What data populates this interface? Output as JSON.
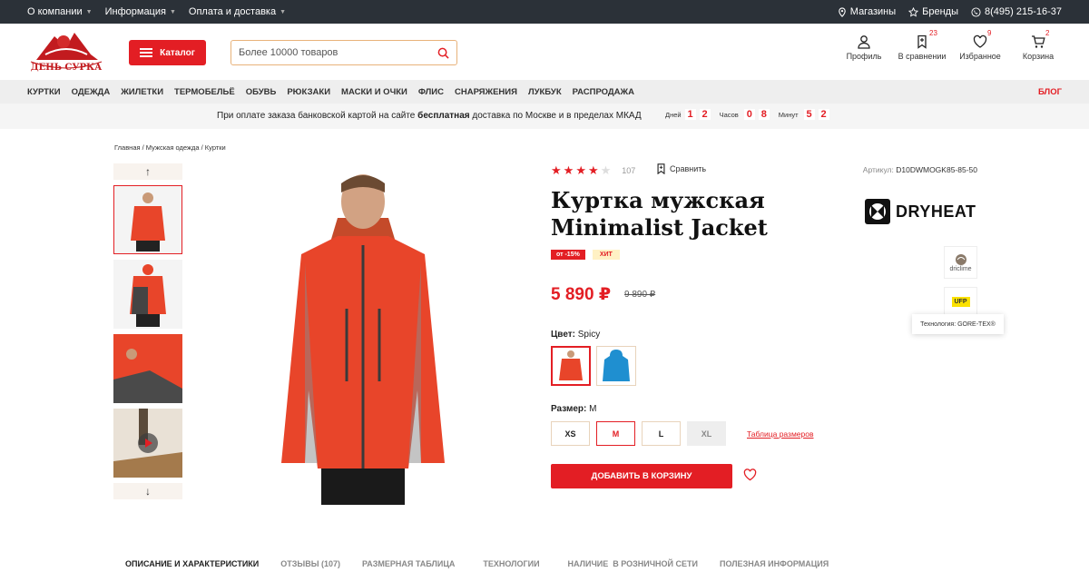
{
  "topbar": {
    "menu": [
      "О компании",
      "Информация",
      "Оплата и доставка"
    ],
    "stores": "Магазины",
    "brands": "Бренды",
    "phone": "8(495) 215-16-37"
  },
  "header": {
    "logo_text": "ДЕНЬ СУРКА",
    "catalog": "Каталог",
    "search_placeholder": "Более 10000 товаров",
    "profile": "Профиль",
    "compare": "В сравнении",
    "compare_count": "23",
    "favorites": "Избранное",
    "favorites_count": "9",
    "cart": "Корзина",
    "cart_count": "2"
  },
  "nav": {
    "items": [
      "КУРТКИ",
      "ОДЕЖДА",
      "ЖИЛЕТКИ",
      "ТЕРМОБЕЛЬЁ",
      "ОБУВЬ",
      "РЮКЗАКИ",
      "МАСКИ И ОЧКИ",
      "ФЛИС",
      "СНАРЯЖЕНИЯ",
      "ЛУКБУК",
      "РАСПРОДАЖА"
    ],
    "blog": "БЛОГ"
  },
  "promo": {
    "text_before": "При оплате заказа банковской картой на сайте ",
    "text_bold": "бесплатная",
    "text_after": " доставка по Москве и в пределах МКАД",
    "days_label": "Дней",
    "days": [
      "1",
      "2"
    ],
    "hours_label": "Часов",
    "hours": [
      "0",
      "8"
    ],
    "minutes_label": "Минут",
    "minutes": [
      "5",
      "2"
    ]
  },
  "breadcrumbs": "Главная  /  Мужская одежда / Куртки",
  "product": {
    "rating": 4,
    "reviews_count": "107",
    "compare": "Сравнить",
    "article_label": "Артикул:",
    "article": "D10DWMOGK85-85-50",
    "title_line1": "Куртка мужская",
    "title_line2": "Minimalist Jacket",
    "badge_sale": "от -15%",
    "badge_hit": "ХИТ",
    "price": "5 890 ₽",
    "old_price": "9 890 ₽",
    "color_label": "Цвет:",
    "color_value": "Spicy",
    "size_label": "Размер:",
    "size_value": "M",
    "sizes": [
      "XS",
      "M",
      "L",
      "XL"
    ],
    "size_table": "Таблица размеров",
    "add_to_cart": "ДОБАВИТЬ В КОРЗИНУ",
    "colors": {
      "accent": "#e31e24",
      "jacket": "#e8452a",
      "jacket_alt": "#1f8fd0"
    }
  },
  "brand": {
    "name": "DRYHEAT",
    "tech1": "driclime",
    "tech2": "UFP",
    "tooltip": "Технология: GORE-TEX®"
  },
  "tabs": [
    "ОПИСАНИЕ И ХАРАКТЕРИСТИКИ",
    "ОТЗЫВЫ (107)",
    "РАЗМЕРНАЯ ТАБЛИЦА",
    "ТЕХНОЛОГИИ",
    "НАЛИЧИЕ  В РОЗНИЧНОЙ СЕТИ",
    "ПОЛЕЗНАЯ ИНФОРМАЦИЯ"
  ]
}
